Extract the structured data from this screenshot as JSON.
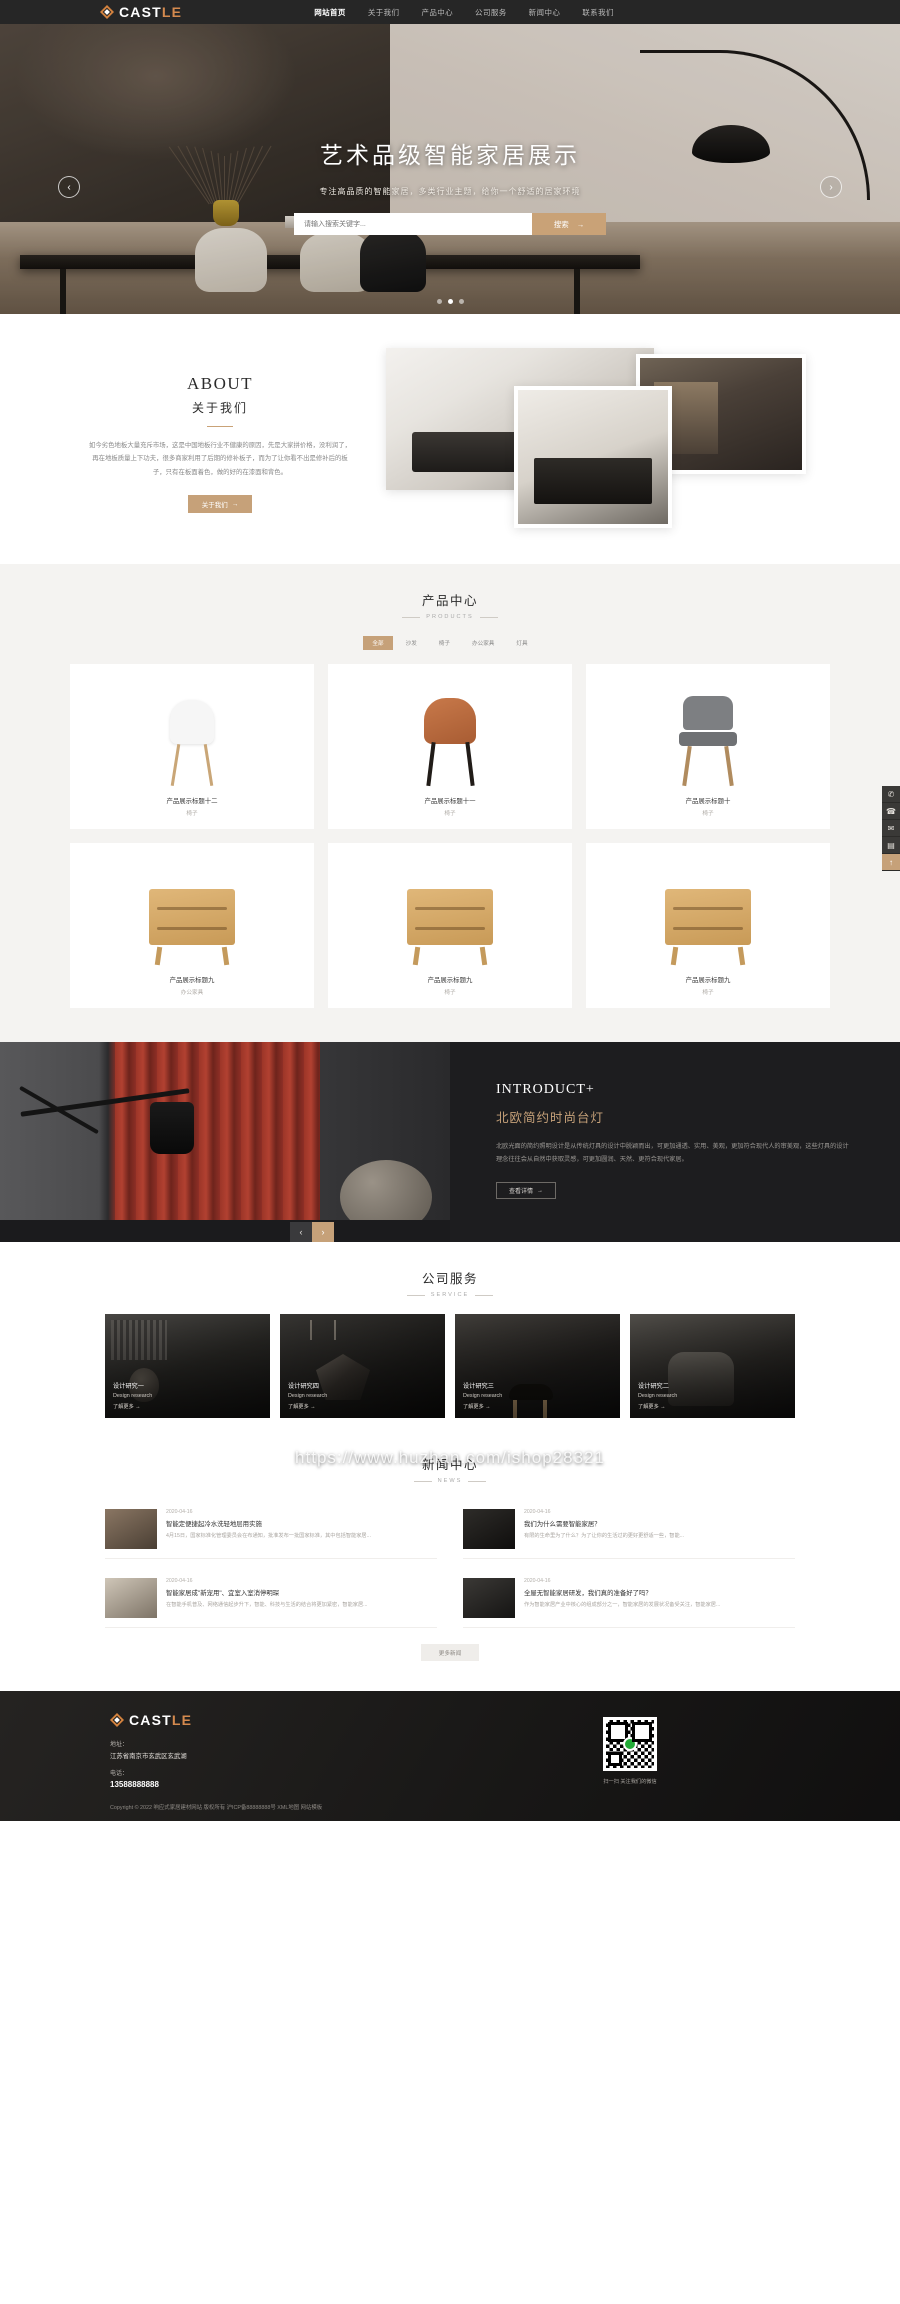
{
  "header": {
    "logo_text_white": "CAST",
    "logo_text_accent": "LE",
    "logo_icon": "diamond-logo-icon",
    "nav": [
      {
        "label": "网站首页",
        "active": true
      },
      {
        "label": "关于我们",
        "active": false
      },
      {
        "label": "产品中心",
        "active": false
      },
      {
        "label": "公司服务",
        "active": false
      },
      {
        "label": "新闻中心",
        "active": false
      },
      {
        "label": "联系我们",
        "active": false
      }
    ]
  },
  "banner": {
    "title": "艺术品级智能家居展示",
    "subtitle": "专注高品质的智能家居，多类行业主题，给你一个舒适的居家环境",
    "search_placeholder": "请输入搜索关键字...",
    "search_value": "",
    "search_button": "搜索",
    "search_button_arrow": "→",
    "prev_icon": "chevron-left-icon",
    "next_icon": "chevron-right-icon",
    "prev_glyph": "‹",
    "next_glyph": "›",
    "dots": 3,
    "active_dot": 1
  },
  "about": {
    "title_en": "ABOUT",
    "title_cn": "关于我们",
    "desc": "如今劣色地板大量充斥市场，这是中国地板行业不健康的原因，先是大家拼价格，没利润了，再在地板质量上下功夫，很多商家利用了后期的修补板子，而为了让你看不出是修补后的板子，只有在板面着色，做的好的在漆面和背色。",
    "button": "关于我们",
    "button_arrow": "→"
  },
  "products": {
    "title": "产品中心",
    "subtitle": "PRODUCTS",
    "tabs": [
      {
        "label": "全部",
        "active": true
      },
      {
        "label": "沙发",
        "active": false
      },
      {
        "label": "椅子",
        "active": false
      },
      {
        "label": "办公家具",
        "active": false
      },
      {
        "label": "灯具",
        "active": false
      }
    ],
    "items": [
      {
        "name": "产品展示标题十二",
        "cat": "椅子",
        "art": "chair-a"
      },
      {
        "name": "产品展示标题十一",
        "cat": "椅子",
        "art": "chair-b"
      },
      {
        "name": "产品展示标题十",
        "cat": "椅子",
        "art": "chair-c"
      },
      {
        "name": "产品展示标题九",
        "cat": "办公家具",
        "art": "cab"
      },
      {
        "name": "产品展示标题九",
        "cat": "椅子",
        "art": "cab"
      },
      {
        "name": "产品展示标题九",
        "cat": "椅子",
        "art": "cab"
      }
    ]
  },
  "introduct": {
    "title_en": "INTRODUCT+",
    "title_cn": "北欧简约时尚台灯",
    "desc": "北欧光面的简约照明设计是从传统灯具的设计中脱颖而出，可更加通透、实用、美观，更加符合现代人的审美观，这些灯具的设计理念往往会从自然中获取灵感，可更加圆润、天然、更符合现代家居。",
    "button": "查看详情",
    "button_arrow": "→",
    "prev_glyph": "‹",
    "next_glyph": "›"
  },
  "services": {
    "title": "公司服务",
    "subtitle": "SERVICE",
    "items": [
      {
        "name": "设计研究一",
        "en": "Design research",
        "more": "了解更多 →",
        "art": "s1"
      },
      {
        "name": "设计研究四",
        "en": "Design research",
        "more": "了解更多 →",
        "art": "s2"
      },
      {
        "name": "设计研究三",
        "en": "Design research",
        "more": "了解更多 →",
        "art": "s3"
      },
      {
        "name": "设计研究二",
        "en": "Design research",
        "more": "了解更多 →",
        "art": "s4"
      }
    ]
  },
  "news": {
    "title": "新闻中心",
    "subtitle": "NEWS",
    "items": [
      {
        "date": "2020-04-16",
        "title": "智能定便捷起冷水洗轻地层用实施",
        "desc": "4月15日，国家标准化管理委员会在布通知，批准发布一批国家标准，其中包括智能家居...",
        "art": "n1"
      },
      {
        "date": "2020-04-16",
        "title": "我们为什么需要智能家居？",
        "desc": "有限的生命里为了什么？为了让你的生活过的更好更舒适一些，智能...",
        "art": "n2"
      },
      {
        "date": "2020-04-16",
        "title": "智能家居成\"新宠用\"、宜室入室消停明琛",
        "desc": "在智能手机普及、网络通信起步升下，智能、科技与生活的结合将更加紧密，智能家居...",
        "art": "n3"
      },
      {
        "date": "2020-04-16",
        "title": "全屋无智能家居研发，我们真的准备好了吗？",
        "desc": "作为智能家居产业中核心的组成部分之一，智能家居的发展状况备受关注，智能家居...",
        "art": "n4"
      }
    ],
    "more_button": "更多新闻"
  },
  "side_tools": [
    {
      "icon": "qq-icon",
      "glyph": "✆"
    },
    {
      "icon": "phone-icon",
      "glyph": "☎"
    },
    {
      "icon": "message-icon",
      "glyph": "✉"
    },
    {
      "icon": "qrcode-icon",
      "glyph": "▤"
    },
    {
      "icon": "back-to-top-icon",
      "glyph": "↑"
    }
  ],
  "footer": {
    "logo_text_white": "CAST",
    "logo_text_accent": "LE",
    "address_label": "地址：",
    "address_value": "江苏省南京市玄武区玄武湖",
    "tel_label": "电话：",
    "tel_value": "13588888888",
    "qr_caption": "扫一扫 关注我们的微信",
    "copyright": "Copyright © 2022 响应式家居建材网站 版权所有 沪ICP备88888888号 XML地图 网站模板"
  },
  "watermark": {
    "line1": "https://www.huzhan.com/ishop28321",
    "line2": "扫一扫 关注我们的微信"
  }
}
